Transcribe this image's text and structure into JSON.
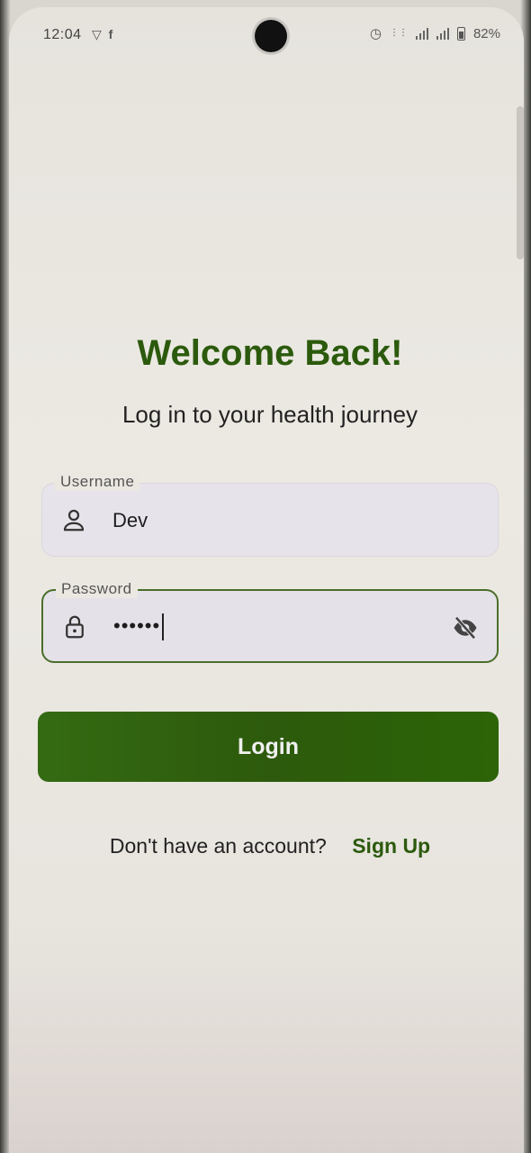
{
  "status_bar": {
    "time": "12:04",
    "left_icons": [
      "shield-icon",
      "facebook-icon"
    ],
    "right_icons": [
      "alarm-icon",
      "volte-icon",
      "signal-icon",
      "signal-icon",
      "battery-icon"
    ],
    "battery": "82%"
  },
  "header": {
    "title": "Welcome Back!",
    "subtitle": "Log in to your health journey"
  },
  "form": {
    "username": {
      "label": "Username",
      "value": "Dev",
      "icon": "person-icon"
    },
    "password": {
      "label": "Password",
      "value": "••••••",
      "icon": "lock-icon",
      "toggle_icon": "eye-off-icon"
    },
    "login_label": "Login"
  },
  "footer": {
    "prompt": "Don't have an account?",
    "signup_label": "Sign Up"
  },
  "colors": {
    "accent": "#2b5a0c",
    "button": "#2d5a0c",
    "background": "#ebe8e2"
  }
}
